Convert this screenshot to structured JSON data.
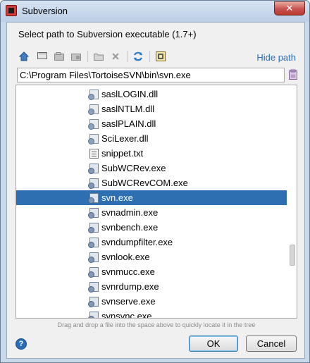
{
  "window": {
    "title": "Subversion",
    "close_glyph": "✕",
    "app_icon": "intellij-icon"
  },
  "dialog": {
    "prompt": "Select path to Subversion executable (1.7+)",
    "hide_path_label": "Hide path",
    "path_value": "C:\\Program Files\\TortoiseSVN\\bin\\svn.exe",
    "hint": "Drag and drop a file into the space above to quickly locate it in the tree",
    "ok_label": "OK",
    "cancel_label": "Cancel",
    "help_glyph": "?"
  },
  "toolbar": {
    "icons": [
      "home-icon",
      "desktop-icon",
      "project-icon",
      "module-icon",
      "new-folder-icon",
      "delete-icon",
      "refresh-icon",
      "show-hidden-icon"
    ]
  },
  "tree": {
    "selected_index": 7,
    "items": [
      {
        "label": "saslLOGIN.dll",
        "type": "dll"
      },
      {
        "label": "saslNTLM.dll",
        "type": "dll"
      },
      {
        "label": "saslPLAIN.dll",
        "type": "dll"
      },
      {
        "label": "SciLexer.dll",
        "type": "dll"
      },
      {
        "label": "snippet.txt",
        "type": "txt"
      },
      {
        "label": "SubWCRev.exe",
        "type": "exe"
      },
      {
        "label": "SubWCRevCOM.exe",
        "type": "exe"
      },
      {
        "label": "svn.exe",
        "type": "exe"
      },
      {
        "label": "svnadmin.exe",
        "type": "exe"
      },
      {
        "label": "svnbench.exe",
        "type": "exe"
      },
      {
        "label": "svndumpfilter.exe",
        "type": "exe"
      },
      {
        "label": "svnlook.exe",
        "type": "exe"
      },
      {
        "label": "svnmucc.exe",
        "type": "exe"
      },
      {
        "label": "svnrdump.exe",
        "type": "exe"
      },
      {
        "label": "svnserve.exe",
        "type": "exe"
      },
      {
        "label": "svnsync.exe",
        "type": "exe"
      }
    ]
  },
  "colors": {
    "selection": "#2d6fb0",
    "link": "#2a6db5"
  }
}
